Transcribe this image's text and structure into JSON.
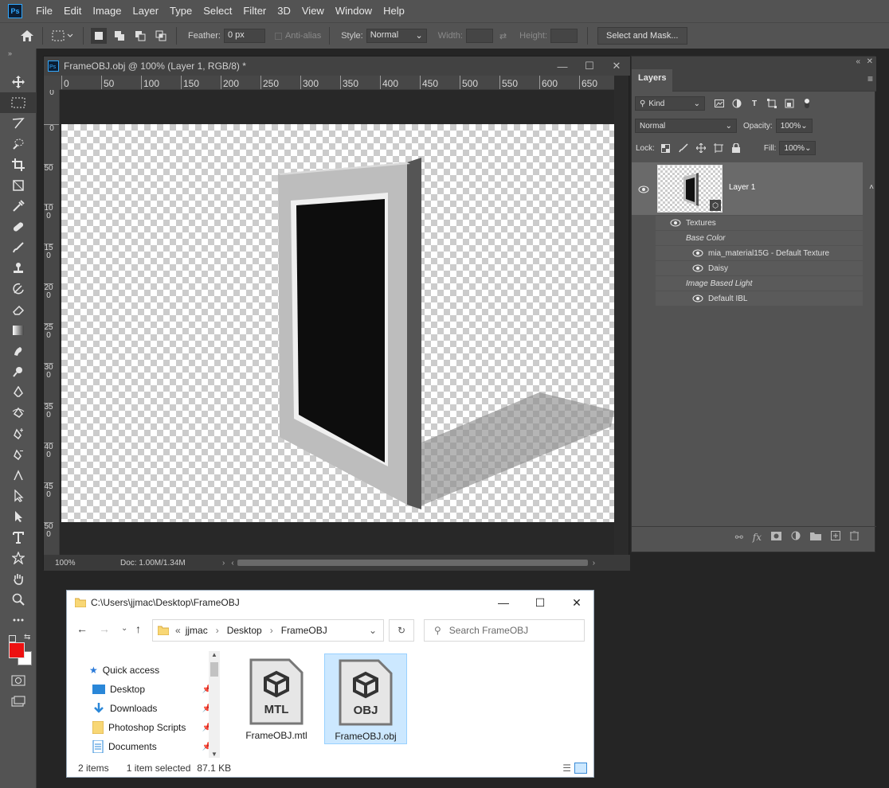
{
  "menubar": {
    "logo": "Ps",
    "items": [
      "File",
      "Edit",
      "Image",
      "Layer",
      "Type",
      "Select",
      "Filter",
      "3D",
      "View",
      "Window",
      "Help"
    ]
  },
  "options": {
    "feather_label": "Feather:",
    "feather_value": "0 px",
    "antialias_label": "Anti-alias",
    "style_label": "Style:",
    "style_value": "Normal",
    "width_label": "Width:",
    "height_label": "Height:",
    "select_mask_label": "Select and Mask..."
  },
  "document": {
    "title": "FrameOBJ.obj @ 100% (Layer 1, RGB/8) *",
    "ruler_h": [
      "0",
      "50",
      "100",
      "150",
      "200",
      "250",
      "300",
      "350",
      "400",
      "450",
      "500",
      "550",
      "600",
      "650"
    ],
    "ruler_v": [
      "0",
      "0",
      "50",
      "100",
      "150",
      "200",
      "250",
      "300",
      "350",
      "400",
      "450",
      "500"
    ],
    "zoom": "100%",
    "doc_info": "Doc: 1.00M/1.34M"
  },
  "layers_panel": {
    "tab": "Layers",
    "filter_kind": "Kind",
    "blend_mode": "Normal",
    "opacity_label": "Opacity:",
    "opacity_value": "100%",
    "lock_label": "Lock:",
    "fill_label": "Fill:",
    "fill_value": "100%",
    "layer_name": "Layer 1",
    "textures_label": "Textures",
    "base_color_label": "Base Color",
    "texture1": "mia_material15G - Default Texture",
    "texture2": "Daisy",
    "ibl_label": "Image Based Light",
    "ibl_item": "Default IBL"
  },
  "explorer": {
    "title": "C:\\Users\\jjmac\\Desktop\\FrameOBJ",
    "path": [
      "jjmac",
      "Desktop",
      "FrameOBJ"
    ],
    "search_placeholder": "Search FrameOBJ",
    "nav": [
      "Quick access",
      "Desktop",
      "Downloads",
      "Photoshop Scripts",
      "Documents"
    ],
    "files": [
      {
        "name": "FrameOBJ.mtl",
        "badge": "MTL"
      },
      {
        "name": "FrameOBJ.obj",
        "badge": "OBJ"
      }
    ],
    "status_count": "2 items",
    "status_selected": "1 item selected",
    "status_size": "87.1 KB"
  },
  "colors": {
    "foreground": "#ee1111",
    "background": "#ffffff",
    "selection": "#cce8ff"
  }
}
